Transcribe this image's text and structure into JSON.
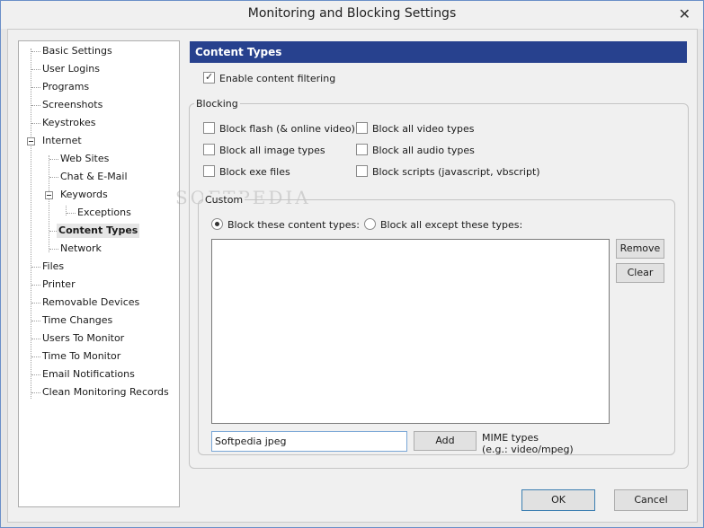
{
  "window": {
    "title": "Monitoring and Blocking Settings",
    "close_glyph": "✕"
  },
  "tree": {
    "items": [
      {
        "label": "Basic Settings"
      },
      {
        "label": "User Logins"
      },
      {
        "label": "Programs"
      },
      {
        "label": "Screenshots"
      },
      {
        "label": "Keystrokes"
      },
      {
        "label": "Internet"
      },
      {
        "label": "Web Sites"
      },
      {
        "label": "Chat & E-Mail"
      },
      {
        "label": "Keywords"
      },
      {
        "label": "Exceptions"
      },
      {
        "label": "Content Types"
      },
      {
        "label": "Network"
      },
      {
        "label": "Files"
      },
      {
        "label": "Printer"
      },
      {
        "label": "Removable Devices"
      },
      {
        "label": "Time Changes"
      },
      {
        "label": "Users To Monitor"
      },
      {
        "label": "Time To Monitor"
      },
      {
        "label": "Email Notifications"
      },
      {
        "label": "Clean Monitoring Records"
      }
    ],
    "selected": "Content Types"
  },
  "panel": {
    "header": "Content Types",
    "enable_filtering": {
      "label": "Enable content filtering",
      "checked": true
    },
    "blocking": {
      "label": "Blocking",
      "options": [
        {
          "label": "Block flash (& online video)",
          "checked": false
        },
        {
          "label": "Block all video types",
          "checked": false
        },
        {
          "label": "Block all image types",
          "checked": false
        },
        {
          "label": "Block all audio types",
          "checked": false
        },
        {
          "label": "Block exe files",
          "checked": false
        },
        {
          "label": "Block scripts (javascript, vbscript)",
          "checked": false
        }
      ]
    },
    "custom": {
      "label": "Custom",
      "radio_block_these": {
        "label": "Block these content types:",
        "selected": true
      },
      "radio_block_except": {
        "label": "Block all except these types:",
        "selected": false
      },
      "list_items": [],
      "remove_label": "Remove",
      "clear_label": "Clear",
      "input_value": "Softpedia jpeg",
      "add_label": "Add",
      "mime_label_line1": "MIME types",
      "mime_label_line2": "(e.g.: video/mpeg)"
    }
  },
  "footer": {
    "ok_label": "OK",
    "cancel_label": "Cancel"
  },
  "watermark": "SOFTPEDIA"
}
